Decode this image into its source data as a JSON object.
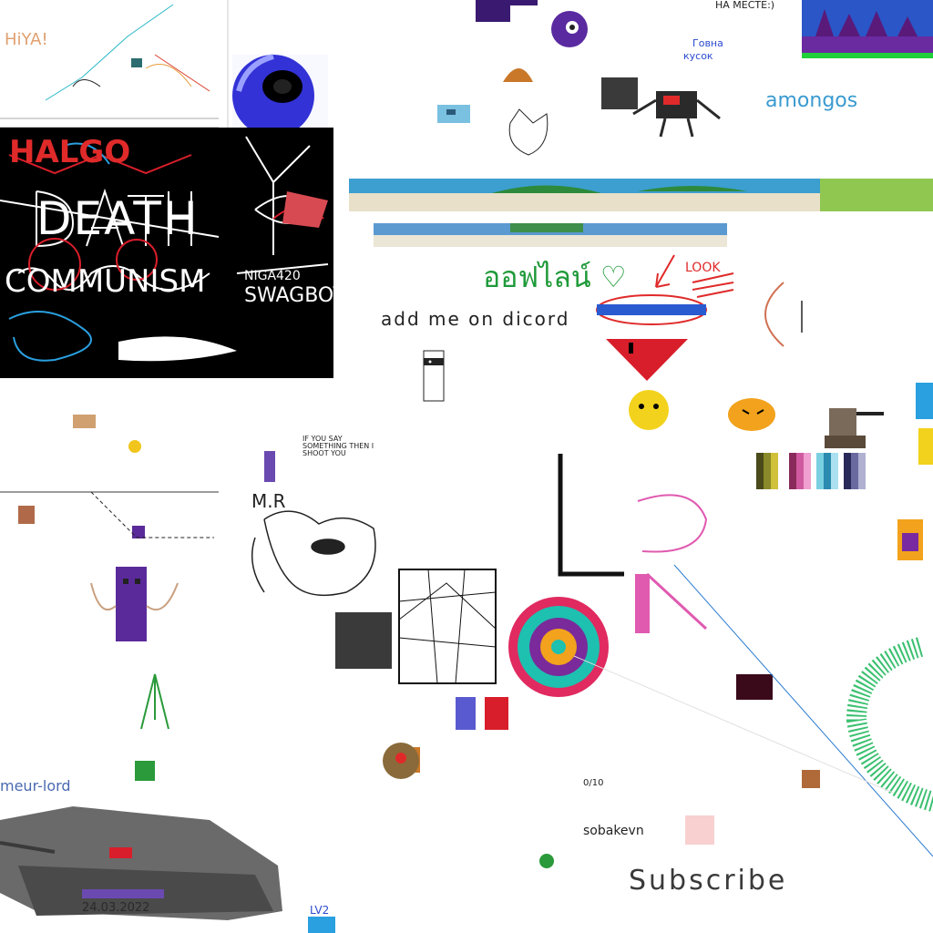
{
  "texts": {
    "halgo_logo": "HALGO",
    "death": "DEATH",
    "communism": "COMMUNISM",
    "swagboys": "SWAGBOYS",
    "niga": "NIGA420",
    "amongos": "amongos",
    "add_me": "add me on dicord",
    "look": "LOOK",
    "thai": "ออฟไลน์ ♡",
    "na_meste": "НА МЕСТЕ:)",
    "gavno1": "Говна",
    "gavno2": "кусок",
    "mr": "M.R",
    "subscribe": "Subscribe",
    "sobakevn": "sobakevn",
    "lv2": "LV2",
    "date": "24.03.2022",
    "hi": "HiYA!",
    "if_you": "IF YOU SAY SOMETHING THEN I SHOOT YOU",
    "ten": "0/10",
    "uni_lord": "meur-lord"
  },
  "colors": {
    "black_panel": "#000000",
    "purple": "#5a2a8a",
    "blue": "#1f2fd0",
    "green": "#1f9a3a",
    "pink": "#e05ab0",
    "red": "#d81e2a",
    "yellow": "#f2c51c",
    "teal": "#1ec0b0"
  }
}
